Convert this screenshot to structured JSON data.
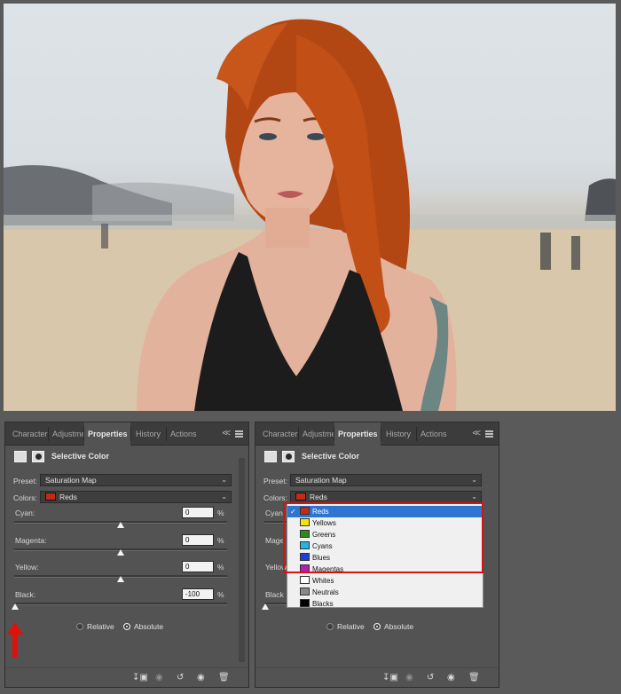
{
  "tabs": [
    {
      "label": "Character"
    },
    {
      "label": "Adjustme"
    },
    {
      "label": "Properties"
    },
    {
      "label": "History"
    },
    {
      "label": "Actions"
    }
  ],
  "collapse_label": "<<",
  "adjustment_title": "Selective Color",
  "preset_label": "Preset:",
  "preset_value": "Saturation Map",
  "colors_label": "Colors:",
  "colors_value": "Reds",
  "accent_color": "#c42a18",
  "sliders": [
    {
      "label": "Cyan:",
      "value": "0",
      "unit": "%",
      "level": 0.5
    },
    {
      "label": "Magenta:",
      "value": "0",
      "unit": "%",
      "level": 0.5
    },
    {
      "label": "Yellow:",
      "value": "0",
      "unit": "%",
      "level": 0.5
    },
    {
      "label": "Black:",
      "value": "-100",
      "unit": "%",
      "level": 0.0
    }
  ],
  "right_slider_labels": [
    "Cyan:",
    "Mage",
    "Yellow",
    "Black"
  ],
  "relative_label": "Relative",
  "absolute_label": "Absolute",
  "method_selected": "Absolute",
  "color_menu": [
    {
      "label": "Reds",
      "color": "#c42a18",
      "selected": true
    },
    {
      "label": "Yellows",
      "color": "#f2e40a",
      "selected": false
    },
    {
      "label": "Greens",
      "color": "#2a8a1e",
      "selected": false
    },
    {
      "label": "Cyans",
      "color": "#25b4e3",
      "selected": false
    },
    {
      "label": "Blues",
      "color": "#1d3fd6",
      "selected": false
    },
    {
      "label": "Magentas",
      "color": "#b51eb0",
      "selected": false
    },
    {
      "label": "Whites",
      "color": "#ffffff",
      "selected": false
    },
    {
      "label": "Neutrals",
      "color": "#8a8a8a",
      "selected": false
    },
    {
      "label": "Blacks",
      "color": "#000000",
      "selected": false
    }
  ],
  "footer_icons": [
    "clip-to-layer-icon",
    "view-previous-icon",
    "reset-icon",
    "visibility-eye-icon",
    "trash-icon"
  ]
}
